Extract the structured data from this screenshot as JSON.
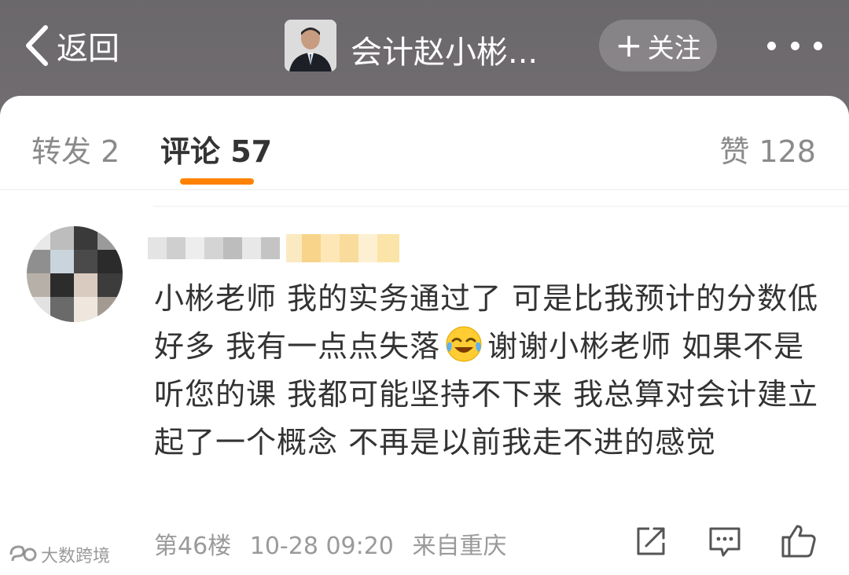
{
  "header": {
    "back_label": "返回",
    "title": "会计赵小彬...",
    "follow_label": "关注",
    "follow_plus": "+"
  },
  "tabs": {
    "repost": "转发 2",
    "comments": "评论 57",
    "likes": "赞 128",
    "active": "comments",
    "accent_color": "#ff8200"
  },
  "comment": {
    "text_1": "小彬老师 我的实务通过了 可是比我预计的分数低好多 我有一点点失落",
    "emoji": "laughing-crying-emoji",
    "text_2": "谢谢小彬老师 如果不是听您的课 我都可能坚持不下来 我总算对会计建立起了一个概念 不再是以前我走不进的感觉",
    "floor": "第46楼",
    "time": "10-28 09:20",
    "source": "来自重庆"
  },
  "watermark": {
    "text": "大数跨境"
  },
  "icons": {
    "back": "chevron-left-icon",
    "more": "more-dots-icon",
    "share": "share-icon",
    "reply": "comment-icon",
    "like": "thumbs-up-icon"
  }
}
